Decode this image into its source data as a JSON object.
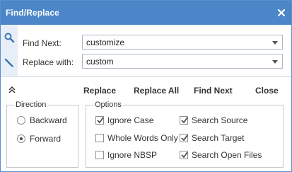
{
  "window": {
    "title": "Find/Replace"
  },
  "find": {
    "label": "Find Next:",
    "value": "customize"
  },
  "replace": {
    "label": "Replace with:",
    "value": "custom"
  },
  "actions": {
    "replace": "Replace",
    "replace_all": "Replace All",
    "find_next": "Find Next",
    "close": "Close"
  },
  "direction": {
    "legend": "Direction",
    "backward": "Backward",
    "forward": "Forward",
    "selected": "Forward"
  },
  "options": {
    "legend": "Options",
    "ignore_case": {
      "label": "Ignore Case",
      "checked": true
    },
    "whole_words": {
      "label": "Whole Words Only",
      "checked": false
    },
    "ignore_nbsp": {
      "label": "Ignore NBSP",
      "checked": false
    },
    "search_source": {
      "label": "Search Source",
      "checked": true
    },
    "search_target": {
      "label": "Search Target",
      "checked": true
    },
    "search_open_files": {
      "label": "Search Open Files",
      "checked": true
    }
  },
  "icons": {
    "close": "close-icon",
    "find": "search-icon",
    "replace": "pencil-icon",
    "collapse": "double-chevron-up-icon"
  },
  "colors": {
    "titlebar": "#4a86c8",
    "accent_icon": "#3a74b8"
  }
}
